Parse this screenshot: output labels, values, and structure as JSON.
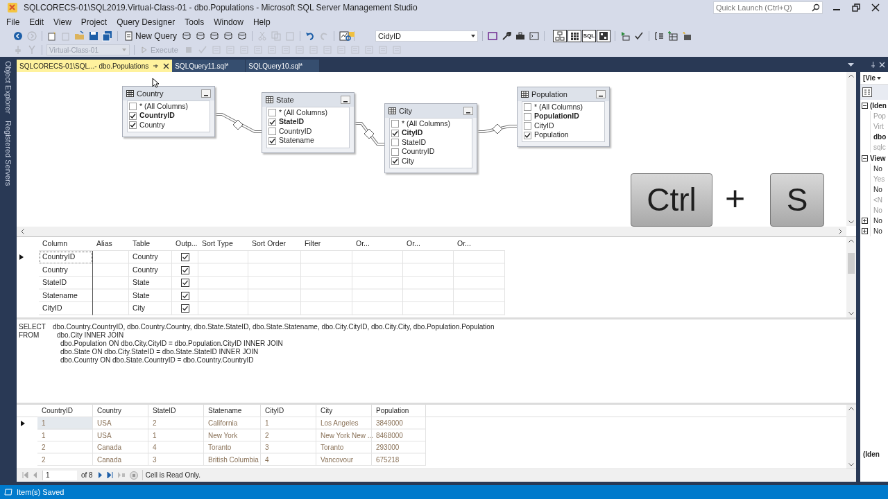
{
  "window": {
    "title": "SQLCORECS-01\\SQL2019.Virtual-Class-01 - dbo.Populations - Microsoft SQL Server Management Studio",
    "quick_launch_placeholder": "Quick Launch (Ctrl+Q)"
  },
  "menu": [
    "File",
    "Edit",
    "View",
    "Project",
    "Query Designer",
    "Tools",
    "Window",
    "Help"
  ],
  "toolbar": {
    "new_query": "New Query",
    "search_combo": "CidyID",
    "pane_buttons": [
      {
        "kind": "diagram",
        "selected": true
      },
      {
        "kind": "grid",
        "selected": true
      },
      {
        "kind": "sql",
        "label": "SQL",
        "selected": true
      },
      {
        "kind": "results",
        "selected": true
      }
    ]
  },
  "query_toolbar": {
    "database": "Virtual-Class-01",
    "database_disabled": true,
    "execute": "Execute",
    "execute_disabled": true
  },
  "side_tabs": [
    "Object Explorer",
    "Registered Servers"
  ],
  "doc_tabs": [
    {
      "label": "SQLCORECS-01\\SQL...- dbo.Populations",
      "selected": true
    },
    {
      "label": "SQLQuery11.sql*",
      "selected": false
    },
    {
      "label": "SQLQuery10.sql*",
      "selected": false
    }
  ],
  "diagram": {
    "tables": [
      {
        "name": "Country",
        "columns": [
          {
            "label": "* (All Columns)",
            "checked": false,
            "key": false
          },
          {
            "label": "CountryID",
            "checked": true,
            "key": true
          },
          {
            "label": "Country",
            "checked": true,
            "key": false
          }
        ]
      },
      {
        "name": "State",
        "columns": [
          {
            "label": "* (All Columns)",
            "checked": false,
            "key": false
          },
          {
            "label": "StateID",
            "checked": true,
            "key": true
          },
          {
            "label": "CountryID",
            "checked": false,
            "key": false
          },
          {
            "label": "Statename",
            "checked": true,
            "key": false
          }
        ]
      },
      {
        "name": "City",
        "columns": [
          {
            "label": "* (All Columns)",
            "checked": false,
            "key": false
          },
          {
            "label": "CityID",
            "checked": true,
            "key": true
          },
          {
            "label": "StateID",
            "checked": false,
            "key": false
          },
          {
            "label": "CountryID",
            "checked": false,
            "key": false
          },
          {
            "label": "City",
            "checked": true,
            "key": false
          }
        ]
      },
      {
        "name": "Population",
        "columns": [
          {
            "label": "* (All Columns)",
            "checked": false,
            "key": false
          },
          {
            "label": "PopulationID",
            "checked": false,
            "key": true
          },
          {
            "label": "CityID",
            "checked": false,
            "key": false
          },
          {
            "label": "Population",
            "checked": true,
            "key": false
          }
        ]
      }
    ]
  },
  "keystroke": {
    "keys": [
      "Ctrl",
      "S"
    ],
    "joiner": "+"
  },
  "criteria": {
    "columns": [
      "Column",
      "Alias",
      "Table",
      "Outp...",
      "Sort Type",
      "Sort Order",
      "Filter",
      "Or...",
      "Or...",
      "Or..."
    ],
    "rows": [
      {
        "column": "CountryID",
        "table": "Country",
        "output": true,
        "selected": true
      },
      {
        "column": "Country",
        "table": "Country",
        "output": true,
        "selected": false
      },
      {
        "column": "StateID",
        "table": "State",
        "output": true,
        "selected": false
      },
      {
        "column": "Statename",
        "table": "State",
        "output": true,
        "selected": false
      },
      {
        "column": "CityID",
        "table": "City",
        "output": true,
        "selected": false
      }
    ]
  },
  "sql": [
    {
      "keyword": "SELECT",
      "text": "dbo.Country.CountryID, dbo.Country.Country, dbo.State.StateID, dbo.State.Statename, dbo.City.CityID, dbo.City.City, dbo.Population.Population"
    },
    {
      "keyword": "FROM",
      "text": "dbo.City INNER JOIN"
    },
    {
      "text": "dbo.Population ON dbo.City.CityID = dbo.Population.CityID INNER JOIN"
    },
    {
      "text": "dbo.State ON dbo.City.StateID = dbo.State.StateID INNER JOIN"
    },
    {
      "text": "dbo.Country ON dbo.State.CountryID = dbo.Country.CountryID"
    }
  ],
  "results": {
    "columns": [
      "CountryID",
      "Country",
      "StateID",
      "Statename",
      "CityID",
      "City",
      "Population"
    ],
    "rows": [
      {
        "cells": [
          "1",
          "USA",
          "2",
          "California",
          "1",
          "Los Angeles",
          "3849000"
        ],
        "selected": true
      },
      {
        "cells": [
          "1",
          "USA",
          "1",
          "New York",
          "2",
          "New York New ...",
          "8468000"
        ],
        "selected": false
      },
      {
        "cells": [
          "2",
          "Canada",
          "4",
          "Toranto",
          "3",
          "Toranto",
          "293000"
        ],
        "selected": false
      },
      {
        "cells": [
          "2",
          "Canada",
          "3",
          "British Columbia",
          "4",
          "Vancovour",
          "675218"
        ],
        "selected": false
      }
    ],
    "pager": {
      "record": "1",
      "of": "of 8",
      "status": "Cell is Read Only."
    }
  },
  "properties": {
    "object_combo": "[Vie",
    "sections": [
      {
        "title": "(Iden",
        "expanded": true,
        "items": [
          {
            "text": "Pop",
            "disabled": true,
            "modified": false
          },
          {
            "text": "Virt",
            "disabled": true,
            "modified": false
          },
          {
            "text": "dbo",
            "disabled": false,
            "modified": true
          },
          {
            "text": "sqlc",
            "disabled": true,
            "modified": false
          }
        ]
      },
      {
        "title": "View",
        "expanded": true,
        "items": [
          {
            "text": "No",
            "disabled": false,
            "modified": false
          },
          {
            "text": "Yes",
            "disabled": true,
            "modified": false
          },
          {
            "text": "No",
            "disabled": false,
            "modified": false
          },
          {
            "text": "<N",
            "disabled": true,
            "modified": false
          },
          {
            "text": "No",
            "disabled": true,
            "modified": false
          },
          {
            "text": "No",
            "disabled": false,
            "modified": false,
            "expanded": false
          },
          {
            "text": "No",
            "disabled": false,
            "modified": false,
            "expanded": false
          }
        ]
      }
    ],
    "description_title": "(Iden"
  },
  "status_bar": "Item(s) Saved"
}
